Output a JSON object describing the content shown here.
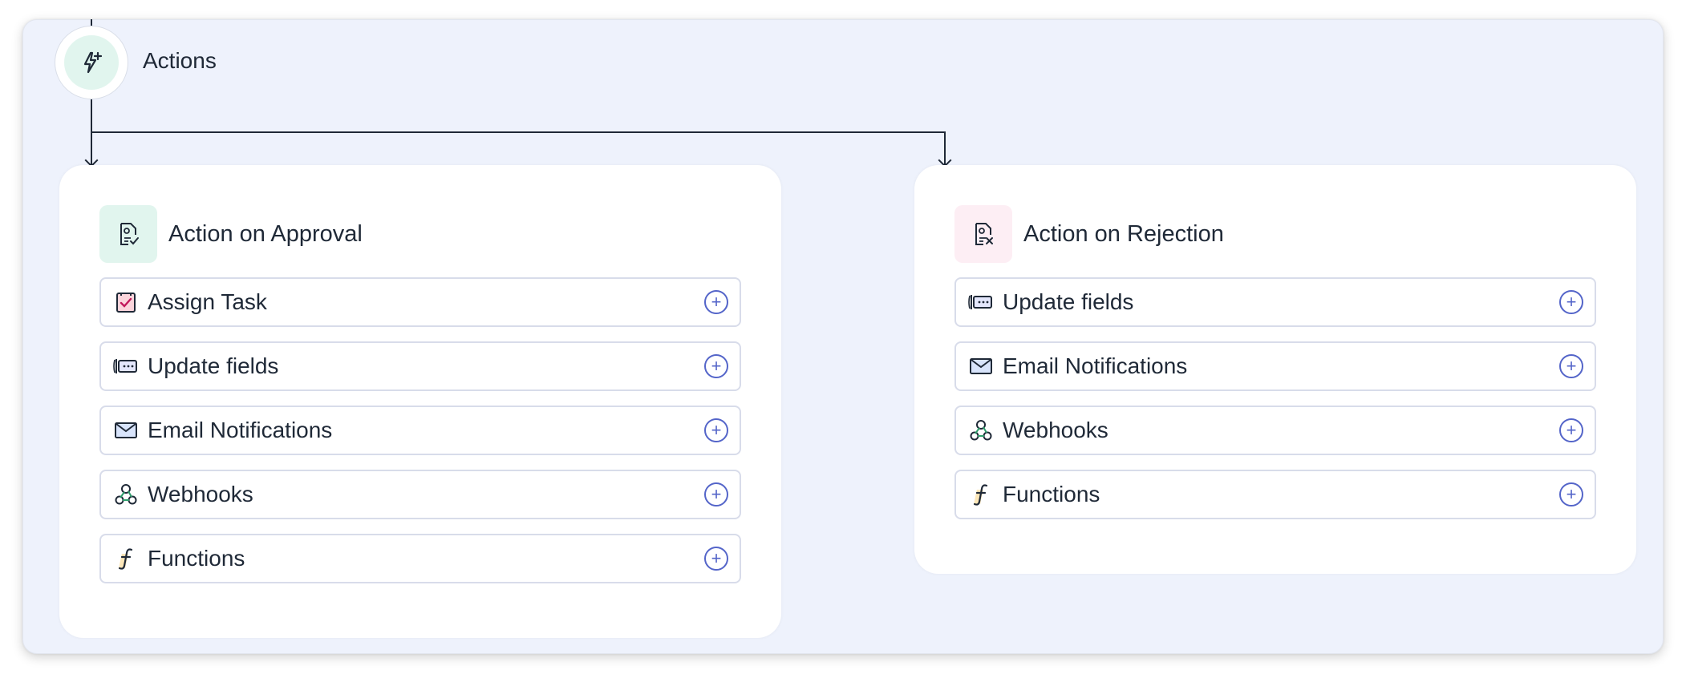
{
  "actions_node": {
    "label": "Actions",
    "icon": "lightning-plus-icon"
  },
  "cards": {
    "approval": {
      "title": "Action on Approval",
      "icon": "document-check-icon",
      "badge_color": "#e1f5ee",
      "items": [
        {
          "label": "Assign Task",
          "icon": "task-checkbox-icon"
        },
        {
          "label": "Update fields",
          "icon": "update-field-icon"
        },
        {
          "label": "Email Notifications",
          "icon": "envelope-icon"
        },
        {
          "label": "Webhooks",
          "icon": "webhook-icon"
        },
        {
          "label": "Functions",
          "icon": "function-icon"
        }
      ]
    },
    "rejection": {
      "title": "Action on Rejection",
      "icon": "document-x-icon",
      "badge_color": "#fdeef4",
      "items": [
        {
          "label": "Update fields",
          "icon": "update-field-icon"
        },
        {
          "label": "Email Notifications",
          "icon": "envelope-icon"
        },
        {
          "label": "Webhooks",
          "icon": "webhook-icon"
        },
        {
          "label": "Functions",
          "icon": "function-icon"
        }
      ]
    }
  },
  "colors": {
    "canvas_bg": "#eef2fc",
    "accent": "#5465c9",
    "connector": "#1f2937"
  }
}
